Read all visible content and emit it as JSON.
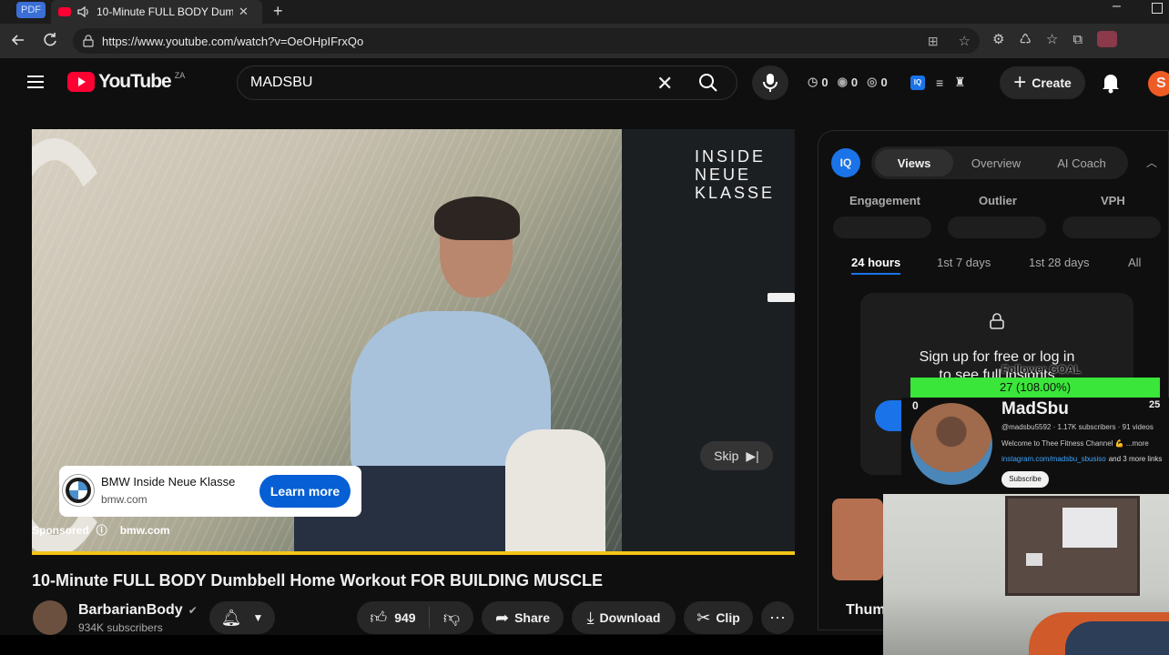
{
  "browser": {
    "pdf_badge": "PDF",
    "tab_title": "10-Minute FULL BODY Dumb",
    "url": "https://www.youtube.com/watch?v=OeOHpIFrxQo"
  },
  "youtube": {
    "logo_text": "YouTube",
    "region": "ZA",
    "search_value": "MADSBU",
    "counters": [
      "0",
      "0",
      "0"
    ],
    "create_label": "Create",
    "avatar_letter": "S"
  },
  "video": {
    "overlay_title_lines": [
      "INSIDE",
      "NEUE",
      "KLASSE"
    ],
    "ad_title": "BMW Inside Neue Klasse",
    "ad_domain": "bmw.com",
    "learn_more": "Learn more",
    "sponsored": "Sponsored",
    "sponsored_domain": "bmw.com",
    "skip_label": "Skip",
    "title": "10-Minute FULL BODY Dumbbell Home Workout FOR BUILDING MUSCLE"
  },
  "channel": {
    "name": "BarbarianBody",
    "subscribers": "934K subscribers"
  },
  "actions": {
    "likes": "949",
    "share": "Share",
    "download": "Download",
    "clip": "Clip"
  },
  "iq": {
    "badge": "IQ",
    "tabs": [
      "Views",
      "Overview",
      "AI Coach"
    ],
    "metrics": [
      "Engagement",
      "Outlier",
      "VPH"
    ],
    "ranges": [
      "24 hours",
      "1st 7 days",
      "1st 28 days",
      "All"
    ],
    "signup_line1": "Sign up for free or log in",
    "signup_line2": "to see full insights"
  },
  "overlay": {
    "goal_label": "Follower GOAL",
    "goal_value": "27 (108.00%)",
    "goal_fraction": 1.0,
    "goal_start": "0",
    "goal_target": "25",
    "name": "MadSbu",
    "handle_info": "@madsbu5592 · 1.17K subscribers · 91 videos",
    "desc": "Welcome to Thee Fitness Channel 💪 ...more",
    "link": "instagram.com/madsbu_sbusiso",
    "more_links": "and 3 more links",
    "subscribe": "Subscribe"
  },
  "related": {
    "partial_title": "Thum"
  },
  "colors": {
    "accent_red": "#ff0033",
    "iq_blue": "#1a73e8",
    "goal_green": "#39e639",
    "link_blue": "#3ea6ff"
  }
}
